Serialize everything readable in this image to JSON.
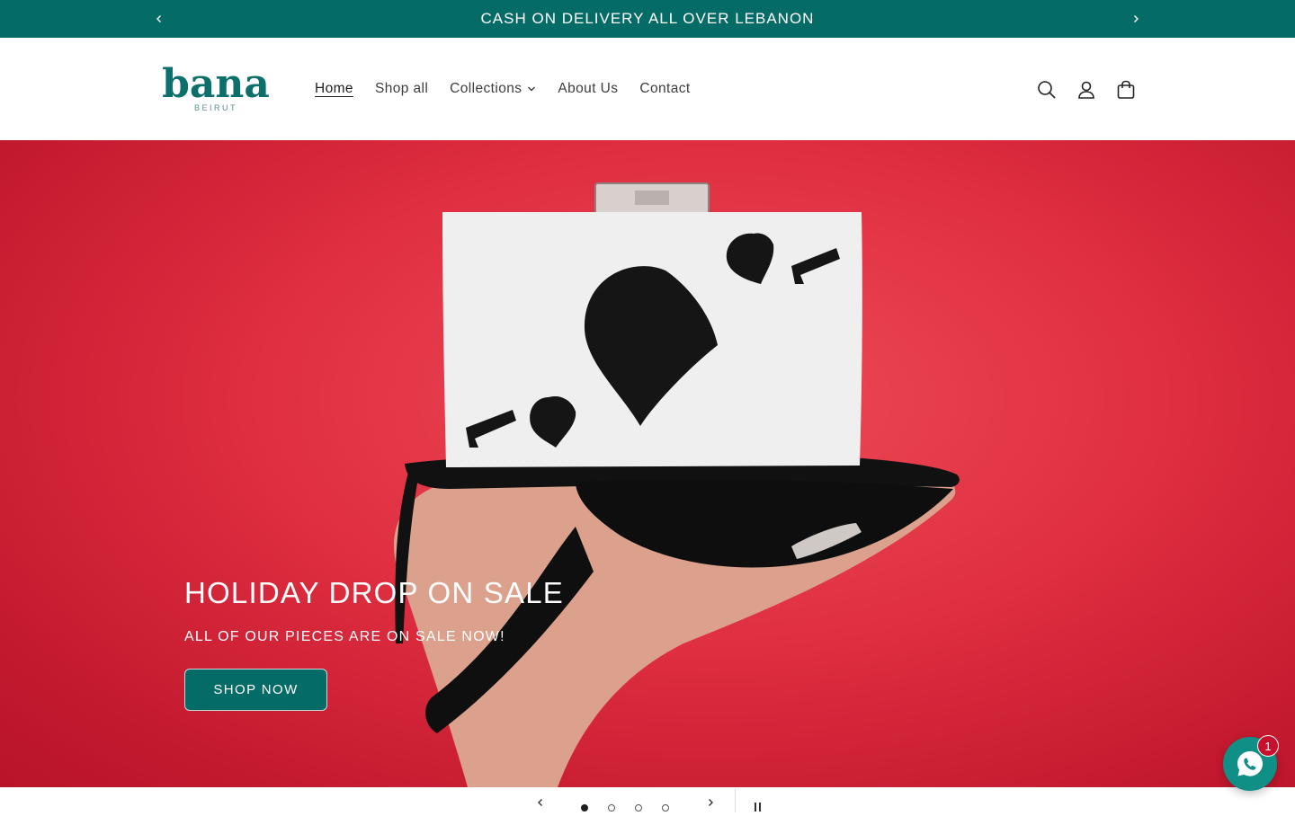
{
  "announcement": {
    "text": "CASH ON DELIVERY ALL OVER LEBANON",
    "prev_icon": "chevron-left-icon",
    "next_icon": "chevron-right-icon"
  },
  "header": {
    "logo": {
      "name": "bana",
      "tagline": "BEIRUT"
    },
    "nav": [
      {
        "label": "Home",
        "active": true
      },
      {
        "label": "Shop all"
      },
      {
        "label": "Collections",
        "has_dropdown": true
      },
      {
        "label": "About Us"
      },
      {
        "label": "Contact"
      }
    ],
    "icons": [
      "search-icon",
      "account-icon",
      "cart-icon"
    ]
  },
  "hero": {
    "title": "HOLIDAY DROP ON SALE",
    "subtitle": "ALL OF OUR PIECES ARE ON SALE NOW!",
    "button_label": "SHOP NOW",
    "background_color": "#df2f40"
  },
  "slider": {
    "total_slides": 4,
    "current_slide": 1,
    "controls": [
      "previous-slide-button",
      "next-slide-button",
      "pause-button"
    ]
  },
  "whatsapp": {
    "badge_count": "1"
  },
  "colors": {
    "brand_teal": "#056b67",
    "badge_red": "#c8102e"
  }
}
